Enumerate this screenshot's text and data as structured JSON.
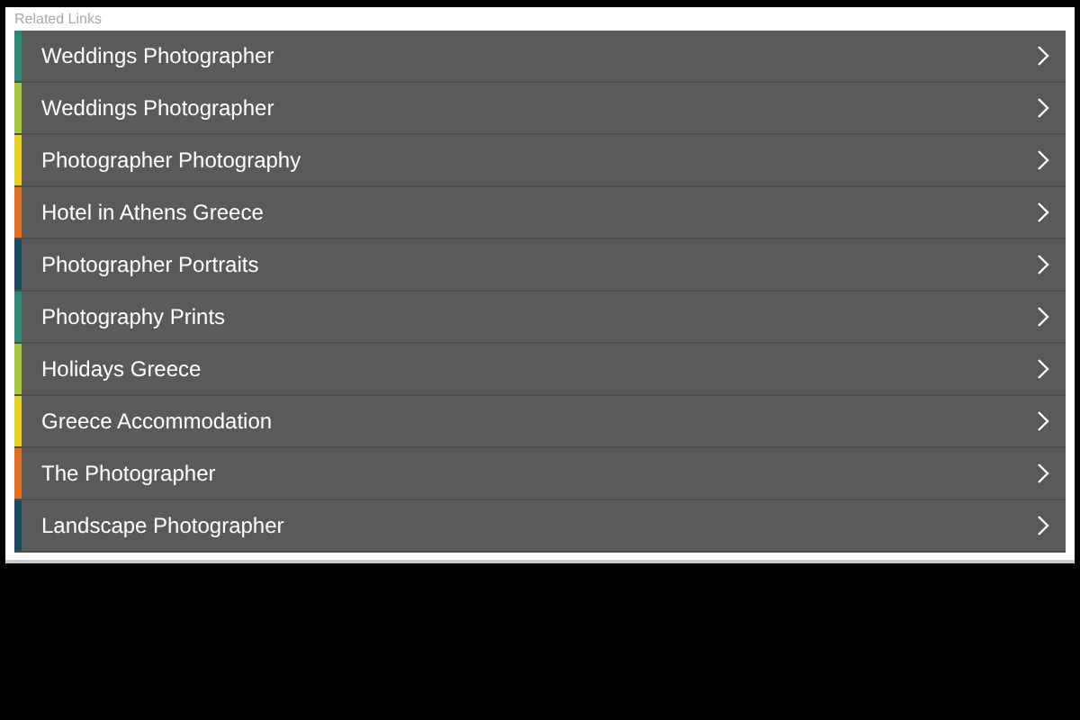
{
  "section": {
    "title": "Related Links"
  },
  "links": [
    {
      "label": "Weddings Photographer",
      "color": "#2a8a78"
    },
    {
      "label": "Weddings Photographer",
      "color": "#a8c83a"
    },
    {
      "label": "Photographer Photography",
      "color": "#e8d020"
    },
    {
      "label": "Hotel in Athens Greece",
      "color": "#e07020"
    },
    {
      "label": "Photographer Portraits",
      "color": "#1a4a60"
    },
    {
      "label": "Photography Prints",
      "color": "#2a8a78"
    },
    {
      "label": "Holidays Greece",
      "color": "#a8c83a"
    },
    {
      "label": "Greece Accommodation",
      "color": "#e8d020"
    },
    {
      "label": "The Photographer",
      "color": "#e07020"
    },
    {
      "label": "Landscape Photographer",
      "color": "#1a4a60"
    }
  ]
}
